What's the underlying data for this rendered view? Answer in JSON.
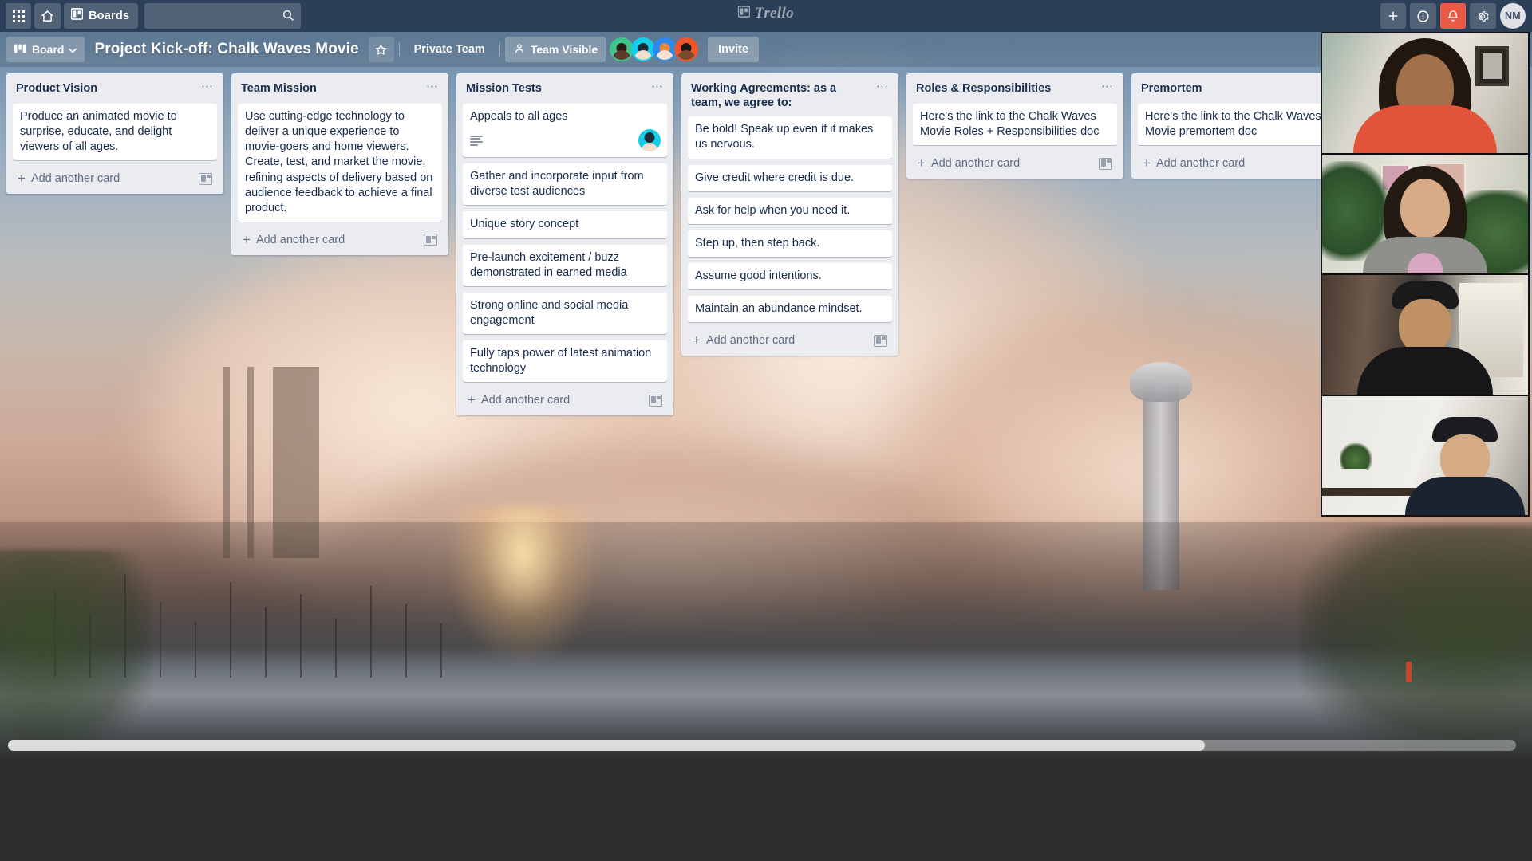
{
  "topnav": {
    "apps_icon": "grid-apps-icon",
    "home_icon": "home-icon",
    "boards_label": "Boards",
    "boards_icon": "board-icon",
    "search": {
      "value": "",
      "placeholder": ""
    },
    "search_icon": "search-icon",
    "brand": "Trello",
    "brand_icon": "trello-board-icon",
    "add_icon": "plus-icon",
    "info_icon": "info-circle-icon",
    "notifications_icon": "bell-icon",
    "settings_icon": "gear-icon",
    "user_initials": "NM",
    "notification_color": "#eb5a46"
  },
  "boardbar": {
    "view_label": "Board",
    "view_icon": "board-view-icon",
    "chevron_icon": "chevron-down-icon",
    "title": "Project Kick-off: Chalk Waves Movie",
    "star_icon": "star-icon",
    "team_label": "Private Team",
    "visibility_label": "Team Visible",
    "visibility_icon": "people-icon",
    "invite_label": "Invite",
    "members": [
      {
        "name": "member-1",
        "bg": "#3fc48b",
        "skin": "#5a3a28",
        "hair": "#2a1b12"
      },
      {
        "name": "member-2",
        "bg": "#14cdea",
        "skin": "#f3ded0",
        "hair": "#1d2a3a"
      },
      {
        "name": "member-3",
        "bg": "#2b8bf0",
        "skin": "#f6e0cf",
        "hair": "#e8883a"
      },
      {
        "name": "member-4",
        "bg": "#f0552c",
        "skin": "#7b4a2c",
        "hair": "#1b1410"
      }
    ]
  },
  "lists": [
    {
      "title": "Product Vision",
      "menu_icon": "list-menu-icon",
      "add_card_label": "Add another card",
      "template_icon": "card-template-icon",
      "cards": [
        {
          "text": "Produce an animated movie to surprise, educate, and delight viewers of all ages."
        }
      ]
    },
    {
      "title": "Team Mission",
      "menu_icon": "list-menu-icon",
      "add_card_label": "Add another card",
      "template_icon": "card-template-icon",
      "cards": [
        {
          "text": "Use cutting-edge technology to deliver a unique experience to movie-goers and home viewers. Create, test, and market the movie, refining aspects of delivery based on audience feedback to achieve a final product."
        }
      ]
    },
    {
      "title": "Mission Tests",
      "menu_icon": "list-menu-icon",
      "add_card_label": "Add another card",
      "template_icon": "card-template-icon",
      "cards": [
        {
          "text": "Appeals to all ages",
          "has_description": true,
          "member": {
            "bg": "#14cdea",
            "skin": "#f3ded0",
            "hair": "#1d2a3a"
          }
        },
        {
          "text": "Gather and incorporate input from diverse test audiences"
        },
        {
          "text": "Unique story concept"
        },
        {
          "text": "Pre-launch excitement / buzz demonstrated in earned media"
        },
        {
          "text": "Strong online and social media engagement"
        },
        {
          "text": "Fully taps power of latest animation technology"
        }
      ]
    },
    {
      "title": "Working Agreements: as a team, we agree to:",
      "menu_icon": "list-menu-icon",
      "add_card_label": "Add another card",
      "template_icon": "card-template-icon",
      "cards": [
        {
          "text": "Be bold! Speak up even if it makes us nervous."
        },
        {
          "text": "Give credit where credit is due."
        },
        {
          "text": "Ask for help when you need it."
        },
        {
          "text": "Step up, then step back."
        },
        {
          "text": "Assume good intentions."
        },
        {
          "text": "Maintain an abundance mindset."
        }
      ]
    },
    {
      "title": "Roles & Responsibilities",
      "menu_icon": "list-menu-icon",
      "add_card_label": "Add another card",
      "template_icon": "card-template-icon",
      "cards": [
        {
          "text": "Here's the link to the Chalk Waves Movie Roles + Responsibilities doc"
        }
      ]
    },
    {
      "title": "Premortem",
      "menu_icon": "list-menu-icon",
      "add_card_label": "Add another card",
      "template_icon": "card-template-icon",
      "cards": [
        {
          "text": "Here's the link to the Chalk Waves Movie premortem doc"
        }
      ]
    }
  ],
  "video_call": {
    "participant_count": 4,
    "tiles": [
      {
        "name": "participant-tile-1"
      },
      {
        "name": "participant-tile-2"
      },
      {
        "name": "participant-tile-3"
      },
      {
        "name": "participant-tile-4"
      }
    ]
  }
}
